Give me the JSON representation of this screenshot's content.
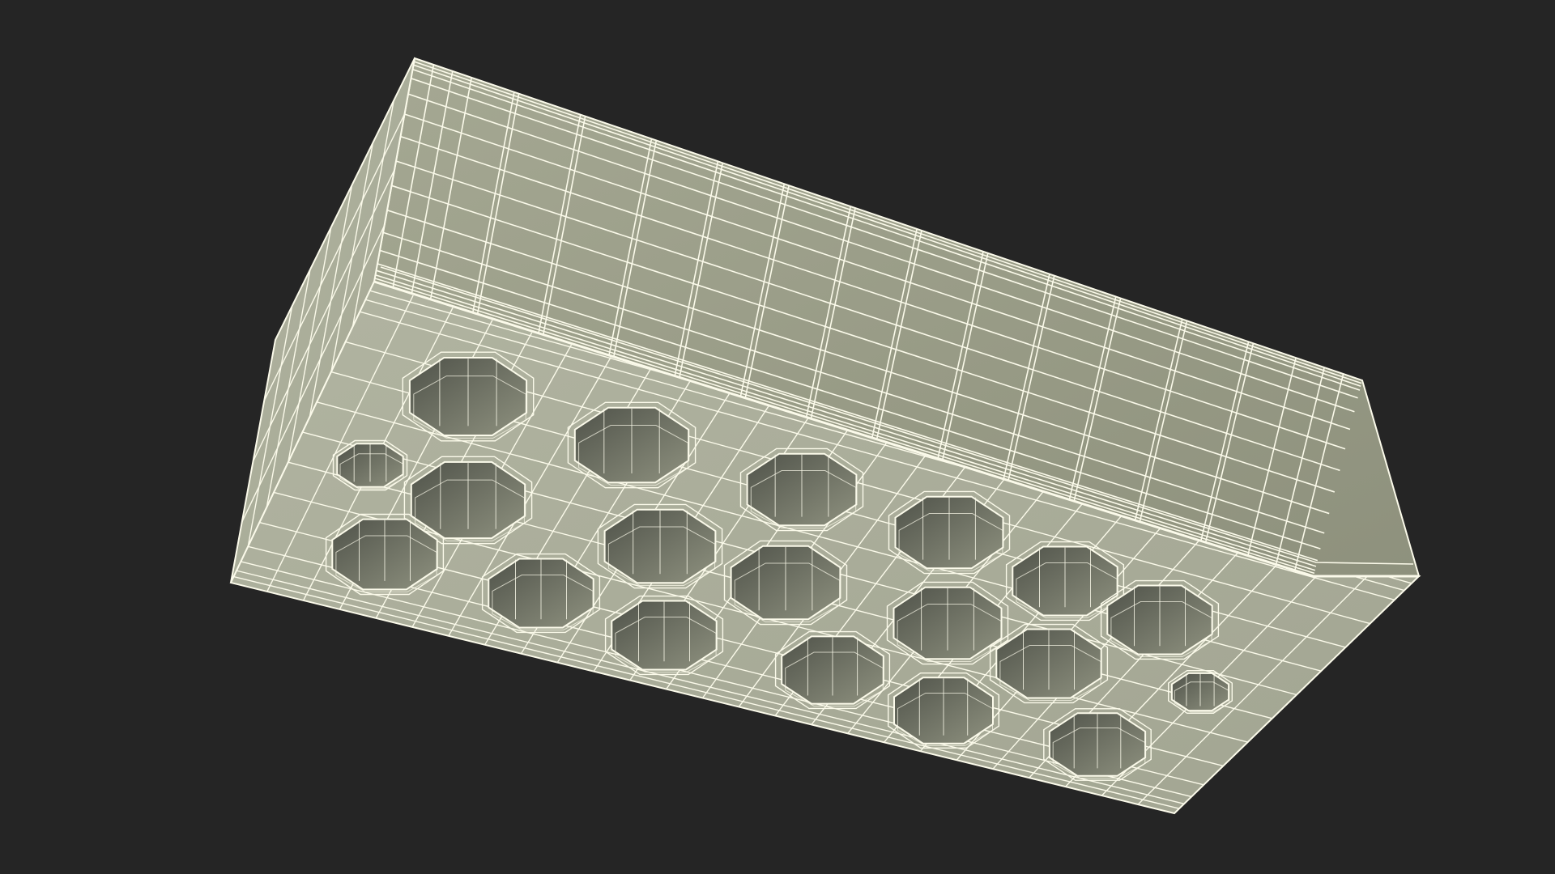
{
  "viewport": {
    "background_color": "#252525"
  },
  "model": {
    "object": "hollow-brick",
    "display_mode": "wireframe-on-shaded",
    "hole_count": 19,
    "colors": {
      "face_top": "#9a9d88",
      "face_front": "#a8ab98",
      "face_end": "#a3a692",
      "hole_interior": "#6c6f5f",
      "wire": "#fbfaea"
    }
  }
}
